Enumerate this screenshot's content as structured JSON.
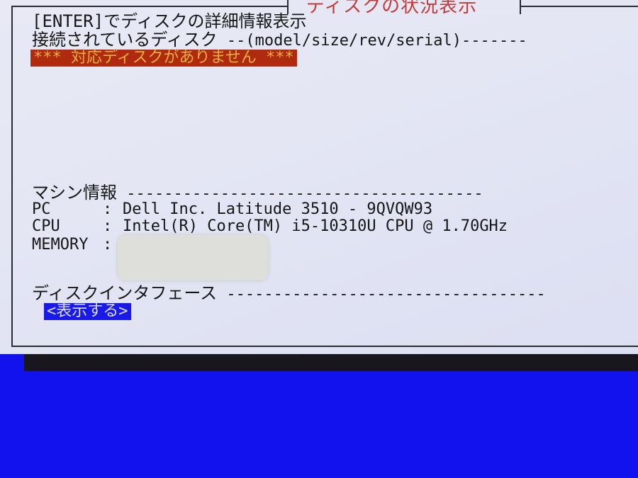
{
  "dialog": {
    "title": "ディスクの状況表示",
    "hint": "[ENTER]でディスクの詳細情報表示",
    "disk_section": {
      "label": "接続されているディスク",
      "columns": "--(model/size/rev/serial)-------",
      "empty_message": "*** 対応ディスクがありません ***"
    },
    "machine_section": {
      "label": "マシン情報",
      "rule": " --------------------------------------",
      "rows": [
        {
          "key": "PC",
          "sep": ":",
          "value": "Dell Inc. Latitude 3510 - 9QVQW93"
        },
        {
          "key": "CPU",
          "sep": ":",
          "value": "Intel(R) Core(TM) i5-10310U CPU @ 1.70GHz"
        },
        {
          "key": "MEMORY",
          "sep": ":",
          "value": ""
        }
      ]
    },
    "interface_section": {
      "label": "ディスクインタフェース",
      "rule": " ----------------------------------",
      "button_label": "<表示する>"
    }
  },
  "colors": {
    "background": "#1212ee",
    "panel": "#e4e6f4",
    "title_text": "#c43a3a",
    "alert_bg": "#b02a10",
    "alert_text": "#e8b040",
    "button_bg": "#1a1ae8",
    "button_text": "#d8dcff"
  }
}
